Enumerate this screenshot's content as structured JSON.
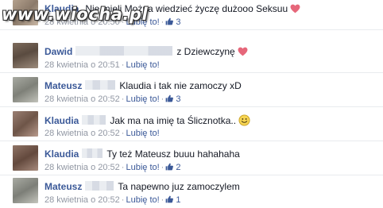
{
  "watermark": "www.wiocha.pl",
  "colors": {
    "name": "#3b5998",
    "meta": "#9197a3",
    "text": "#141823",
    "heart": "#e6677a"
  },
  "comments": [
    {
      "name": "Klaudia",
      "text": "Nie mieli Można wiedzieć życzę dużooo Seksuu",
      "emoji": "heart-icon",
      "time": "28 kwietnia o 20:50",
      "like_label": "Lubię to!",
      "likes": "3"
    },
    {
      "name": "Dawid",
      "text": "z Dziewczynę",
      "emoji": "heart-icon",
      "time": "28 kwietnia o 20:51",
      "like_label": "Lubię to!",
      "likes": ""
    },
    {
      "name": "Mateusz",
      "text": "Klaudia i tak nie zamoczy xD",
      "emoji": "",
      "time": "28 kwietnia o 20:52",
      "like_label": "Lubię to!",
      "likes": "3"
    },
    {
      "name": "Klaudia",
      "text": "Jak ma na imię ta Ślicznotka..",
      "emoji": "smiley-icon",
      "time": "28 kwietnia o 20:52",
      "like_label": "Lubię to!",
      "likes": ""
    },
    {
      "name": "Klaudia",
      "text": "Ty też Mateusz buuu hahahaha",
      "emoji": "",
      "time": "28 kwietnia o 20:52",
      "like_label": "Lubię to!",
      "likes": "2"
    },
    {
      "name": "Mateusz",
      "text": "Ta napewno juz zamoczylem",
      "emoji": "",
      "time": "28 kwietnia o 20:52",
      "like_label": "Lubię to!",
      "likes": "1"
    }
  ]
}
